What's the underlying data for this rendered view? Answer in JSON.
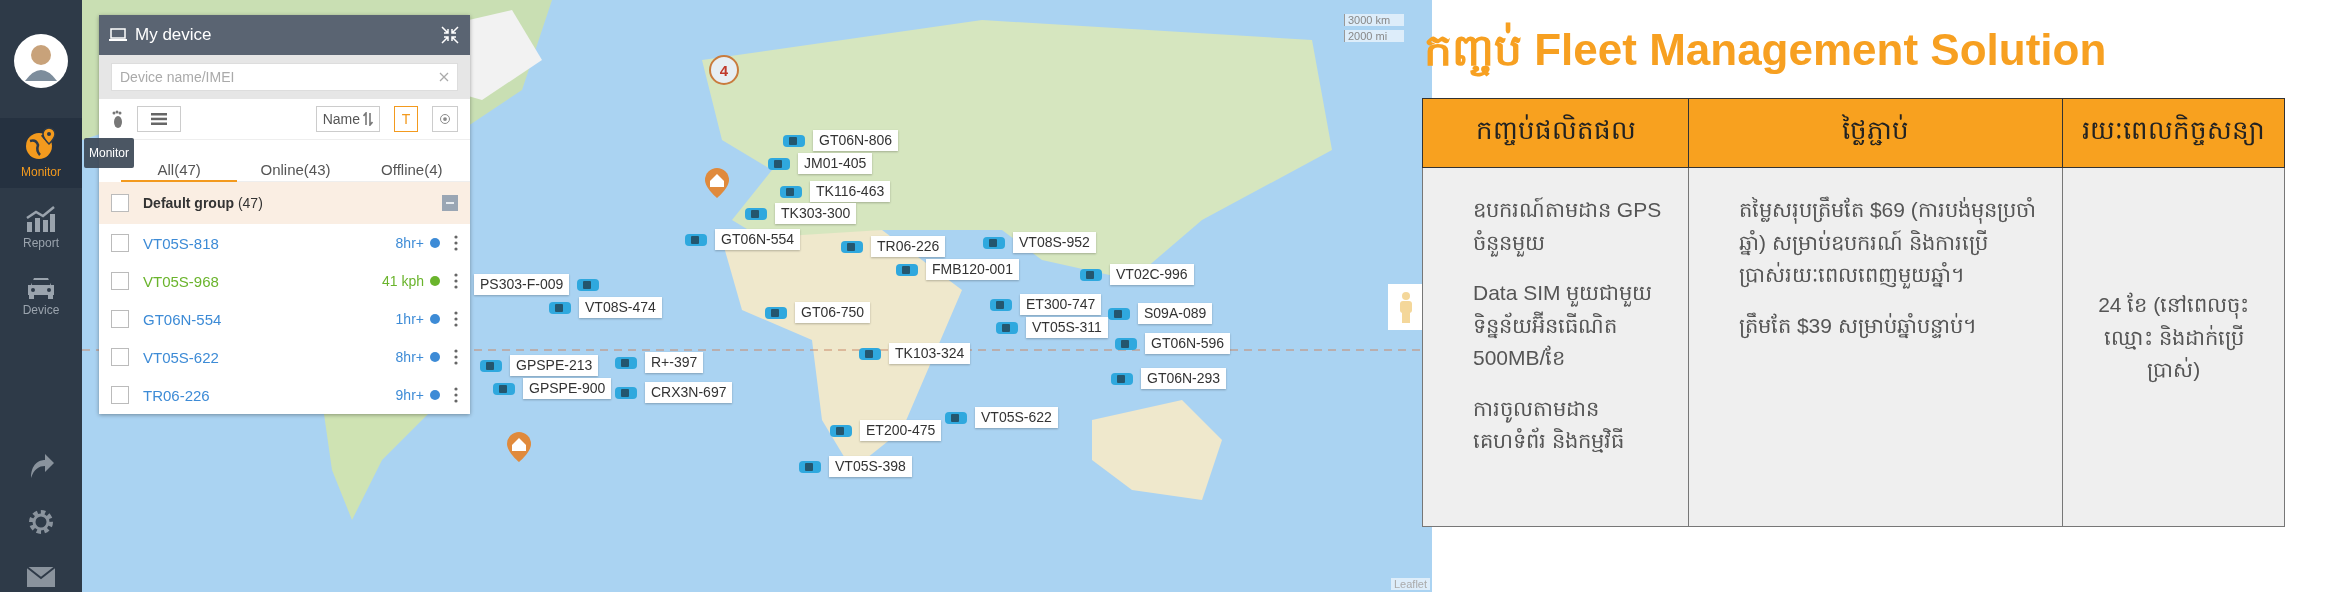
{
  "sidebar": {
    "items": [
      {
        "label": "Monitor",
        "kind": "monitor",
        "selected": true
      },
      {
        "label": "Report",
        "kind": "report",
        "selected": false
      },
      {
        "label": "Device",
        "kind": "device",
        "selected": false
      }
    ],
    "tooltip": "Monitor"
  },
  "device_panel": {
    "title": "My device",
    "search": {
      "placeholder": "Device name/IMEI"
    },
    "sort_button": "Name",
    "text_toggle": {
      "label": "T",
      "on": true
    },
    "tabs": [
      {
        "label": "All(47)",
        "selected": true
      },
      {
        "label": "Online(43)",
        "selected": false
      },
      {
        "label": "Offline(4)",
        "selected": false
      }
    ],
    "group": {
      "name": "Default group",
      "count": "(47)",
      "expanded": true,
      "checked": false
    },
    "devices": [
      {
        "name": "VT05S-818",
        "status": "8hr+",
        "color": "#3d8bd6",
        "checked": false
      },
      {
        "name": "VT05S-968",
        "status": "41 kph",
        "color": "#6ab42c",
        "checked": false
      },
      {
        "name": "GT06N-554",
        "status": "1hr+",
        "color": "#3d8bd6",
        "checked": false
      },
      {
        "name": "VT05S-622",
        "status": "8hr+",
        "color": "#3d8bd6",
        "checked": false
      },
      {
        "name": "TR06-226",
        "status": "9hr+",
        "color": "#3d8bd6",
        "checked": false
      }
    ]
  },
  "map": {
    "cluster": "4",
    "scale": [
      "3000 km",
      "2000 mi"
    ],
    "attribution": "Leaflet",
    "markers": [
      {
        "label": "GT06N-806"
      },
      {
        "label": "JM01-405"
      },
      {
        "label": "TK116-463"
      },
      {
        "label": "TK303-300"
      },
      {
        "label": "GT06N-554"
      },
      {
        "label": "TR06-226"
      },
      {
        "label": "FMB120-001"
      },
      {
        "label": "VT08S-952"
      },
      {
        "label": "VT02C-996"
      },
      {
        "label": "PS303-F-009"
      },
      {
        "label": "VT08S-474"
      },
      {
        "label": "GT06-750"
      },
      {
        "label": "ET300-747"
      },
      {
        "label": "S09A-089"
      },
      {
        "label": "VT05S-311"
      },
      {
        "label": "GT06N-596"
      },
      {
        "label": "TK103-324"
      },
      {
        "label": "R+-397"
      },
      {
        "label": "GPSPE-213"
      },
      {
        "label": "GT06N-293"
      },
      {
        "label": "GPSPE-900"
      },
      {
        "label": "CRX3N-697"
      },
      {
        "label": "VT05S-622"
      },
      {
        "label": "ET200-475"
      },
      {
        "label": "VT05S-398"
      }
    ]
  },
  "offer": {
    "title": "កញ្ចប់ Fleet Management Solution",
    "table": {
      "columns": [
        "កញ្ចប់ផលិតផល",
        "ថ្លៃភ្ជាប់",
        "រយៈពេលកិច្ចសន្យា"
      ],
      "rows": [
        {
          "cells": [
            {
              "paragraphs": [
                "ឧបករណ៍តាមដាន GPS ចំនួនមួយ",
                "Data SIM មួយជាមួយទិន្នន័យអ៊ីនធើណិត 500MB/ខែ",
                "ការចូលតាមដានគេហទំព័រ និងកម្មវិធី"
              ]
            },
            {
              "paragraphs": [
                "តម្លៃសរុបត្រឹមតែ $69 (ការបង់មុនប្រចាំឆ្នាំ) សម្រាប់ឧបករណ៍ និងការប្រើប្រាស់រយៈពេលពេញមួយឆ្នាំ។",
                "ត្រឹមតែ $39 សម្រាប់ឆ្នាំបន្ទាប់។"
              ]
            },
            {
              "paragraphs": [
                "24 ខែ (នៅពេលចុះឈ្មោះ និងដាក់ប្រើប្រាស់)"
              ]
            }
          ]
        }
      ]
    }
  }
}
